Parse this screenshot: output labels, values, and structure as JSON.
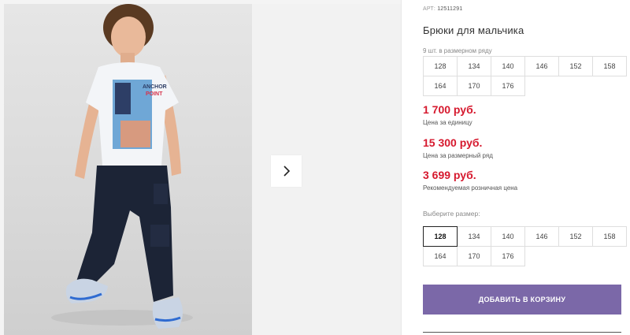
{
  "product": {
    "sku_label": "АРТ:",
    "sku_value": "12511291",
    "title": "Брюки для мальчика",
    "row_count_text": "9 шт. в размерном ряду"
  },
  "size_row": [
    "128",
    "134",
    "140",
    "146",
    "152",
    "158",
    "164",
    "170",
    "176"
  ],
  "prices": [
    {
      "value": "1 700 руб.",
      "label": "Цена за единицу"
    },
    {
      "value": "15 300 руб.",
      "label": "Цена за размерный ряд"
    },
    {
      "value": "3 699 руб.",
      "label": "Рекомендуемая розничная цена"
    }
  ],
  "size_select": {
    "label": "Выберите размер:",
    "options": [
      "128",
      "134",
      "140",
      "146",
      "152",
      "158",
      "164",
      "170",
      "176"
    ],
    "selected": "128"
  },
  "cart_button": "ДОБАВИТЬ В КОРЗИНУ",
  "photo": {
    "shirt_text_1": "ANCHOR",
    "shirt_text_2": "POINT"
  },
  "colors": {
    "price": "#d6192e",
    "button": "#7b68a8",
    "pants": "#1c2436"
  },
  "icons": {
    "next": "chevron-right-icon"
  }
}
